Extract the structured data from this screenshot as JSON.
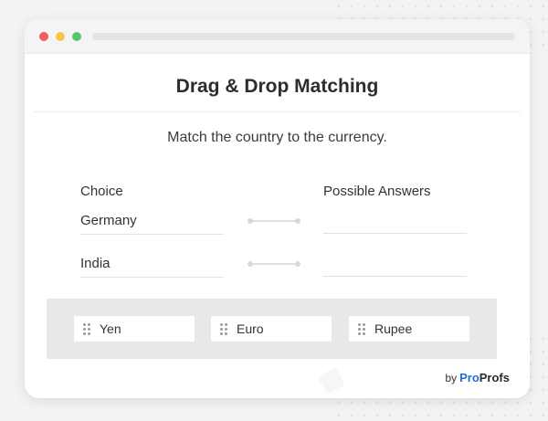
{
  "window": {
    "traffic_lights": {
      "red": "#ee5f5b",
      "yellow": "#f5c84c",
      "green": "#54c96b"
    }
  },
  "quiz": {
    "title": "Drag & Drop Matching",
    "instruction": "Match the country to the currency.",
    "choice_header": "Choice",
    "answers_header": "Possible Answers",
    "choices": [
      {
        "label": "Germany",
        "answer": ""
      },
      {
        "label": "India",
        "answer": ""
      }
    ],
    "options": [
      {
        "label": "Yen",
        "icon": "drag-handle-icon"
      },
      {
        "label": "Euro",
        "icon": "drag-handle-icon"
      },
      {
        "label": "Rupee",
        "icon": "drag-handle-icon"
      }
    ]
  },
  "branding": {
    "by": "by",
    "pro": "Pro",
    "profs": "Profs",
    "accent_color": "#1f6fd8"
  }
}
